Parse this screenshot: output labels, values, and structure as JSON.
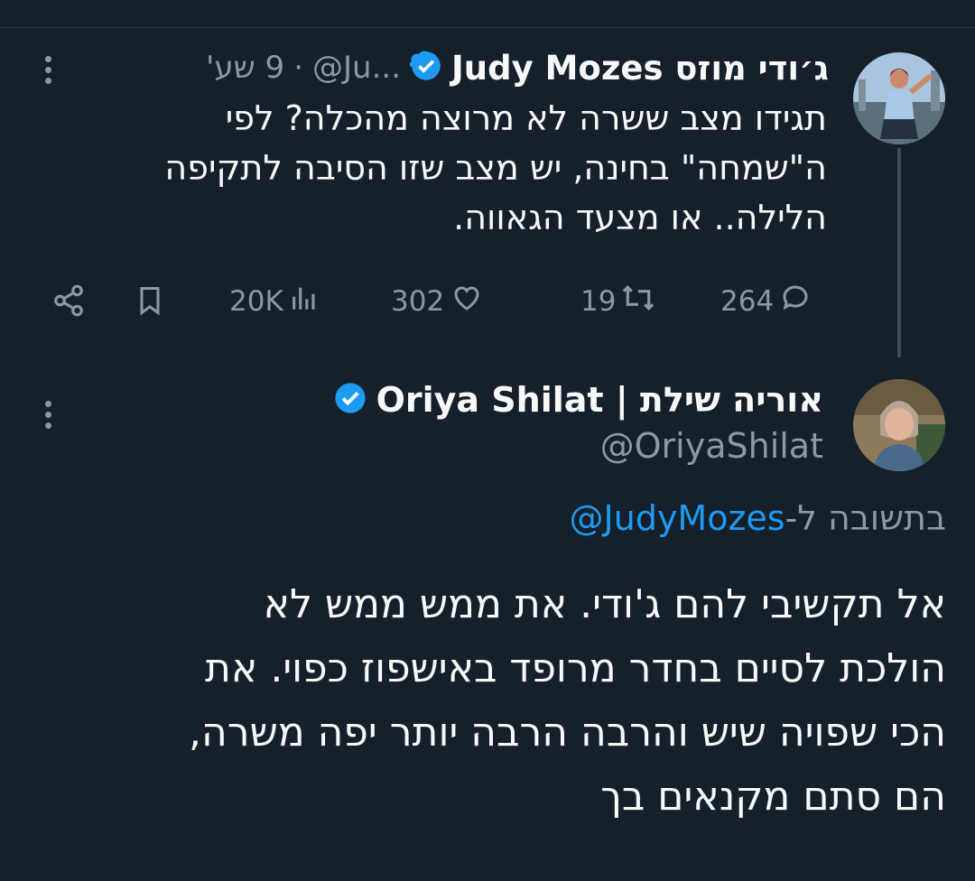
{
  "parent_tweet": {
    "display_name": "ג׳ודי מוזס Judy Mozes",
    "handle_truncated": "@Ju...",
    "separator": "·",
    "time": "9 שע'",
    "text_lines": [
      "תגידו מצב ששרה לא מרוצה מהכלה? לפי",
      "ה\"שמחה\" בחינה, יש מצב שזו הסיבה לתקיפה",
      "הלילה.. או מצעד הגאווה."
    ],
    "actions": {
      "replies": "264",
      "retweets": "19",
      "likes": "302",
      "views": "20K"
    }
  },
  "reply_tweet": {
    "display_name": "אוריה שילת | Oriya Shilat",
    "handle": "@OriyaShilat",
    "replying_to_prefix": "בתשובה ל-",
    "replying_to_handle": "@JudyMozes",
    "text_lines": [
      "אל תקשיבי להם ג'ודי. את ממש ממש לא",
      "הולכת לסיים בחדר מרופד באישפוז כפוי. את",
      "הכי שפויה שיש והרבה הרבה יותר יפה משרה,",
      "הם סתם מקנאים בך"
    ]
  },
  "colors": {
    "background": "#15202b",
    "text": "#f7f9f9",
    "secondary": "#8b98a5",
    "accent": "#1d9bf0"
  },
  "icons": [
    "reply-icon",
    "retweet-icon",
    "like-icon",
    "views-icon",
    "bookmark-icon",
    "share-icon",
    "verified-badge-icon",
    "more-icon"
  ]
}
